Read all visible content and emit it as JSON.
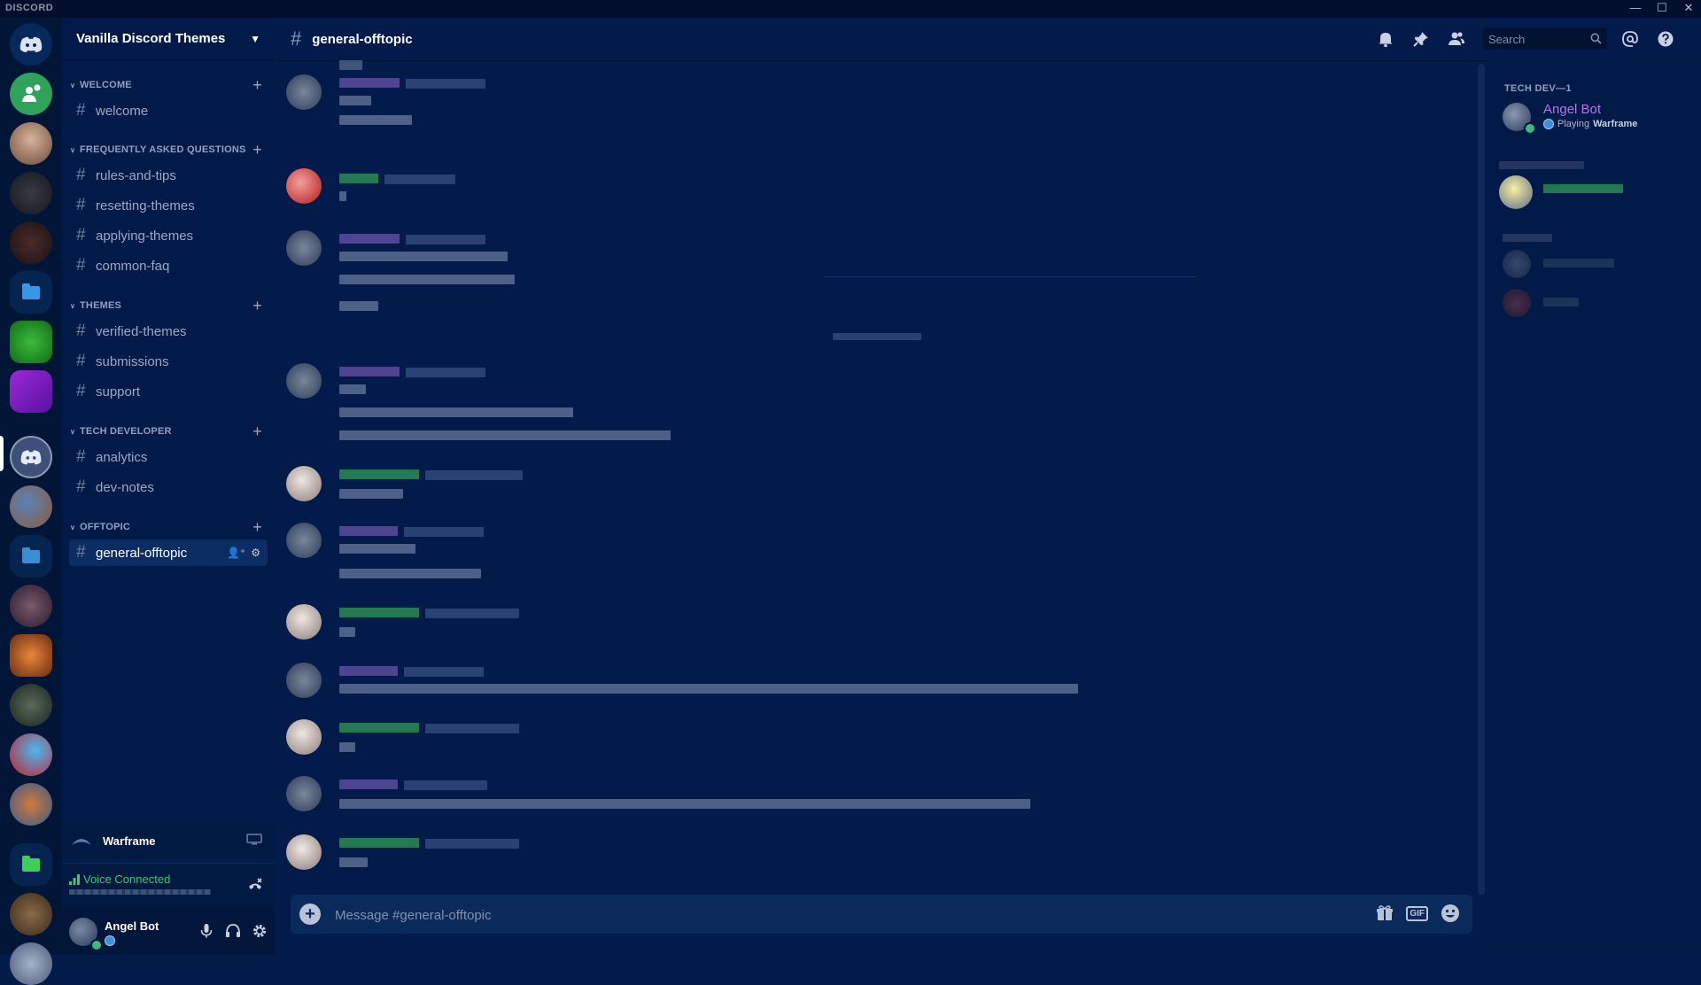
{
  "window": {
    "brand": "DISCORD",
    "controls": [
      "minimize",
      "maximize",
      "close"
    ]
  },
  "server": {
    "name": "Vanilla Discord Themes"
  },
  "categories": [
    {
      "label": "WELCOME",
      "channels": [
        "welcome"
      ]
    },
    {
      "label": "FREQUENTLY ASKED QUESTIONS",
      "channels": [
        "rules-and-tips",
        "resetting-themes",
        "applying-themes",
        "common-faq"
      ]
    },
    {
      "label": "THEMES",
      "channels": [
        "verified-themes",
        "submissions",
        "support"
      ]
    },
    {
      "label": "TECH DEVELOPER",
      "channels": [
        "analytics",
        "dev-notes"
      ]
    },
    {
      "label": "OFFTOPIC",
      "channels": [
        "general-offtopic"
      ]
    }
  ],
  "current_channel": "general-offtopic",
  "activity": {
    "game": "Warframe"
  },
  "voice": {
    "status": "Voice Connected"
  },
  "user": {
    "name": "Angel Bot"
  },
  "search": {
    "placeholder": "Search"
  },
  "composer": {
    "placeholder": "Message #general-offtopic",
    "gif_label": "GIF"
  },
  "members": {
    "role_header": "TECH DEV—1",
    "member_name": "Angel Bot",
    "status_prefix": "Playing",
    "status_game": "Warframe"
  },
  "colors": {
    "background": "#021b4a",
    "sidebar": "#021a47",
    "accent_online": "#43b581",
    "member_name": "#b776e8"
  },
  "icons": [
    "discord-logo-icon",
    "add-friend-icon",
    "folder-icon",
    "bell-icon",
    "pin-icon",
    "members-icon",
    "search-icon",
    "at-mention-icon",
    "help-icon",
    "hash-icon",
    "plus-icon",
    "mic-icon",
    "headphones-icon",
    "gear-icon",
    "gift-icon",
    "emoji-icon",
    "disconnect-icon",
    "screen-share-icon"
  ]
}
